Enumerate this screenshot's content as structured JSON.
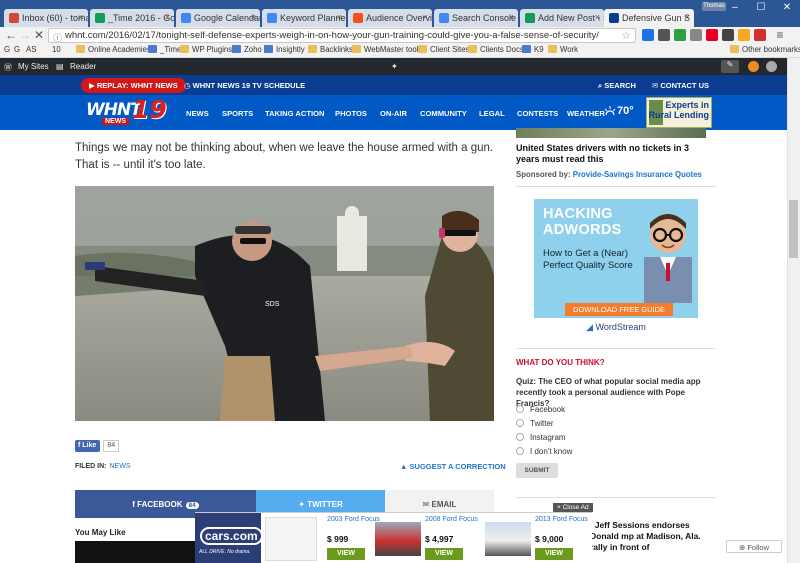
{
  "browser": {
    "tabs": [
      {
        "title": "Inbox (60) - toman",
        "color": "#d44638"
      },
      {
        "title": "_Time 2016 - Goog",
        "color": "#0f9d58"
      },
      {
        "title": "Google Calendar -",
        "color": "#4285f4"
      },
      {
        "title": "Keyword Planner -",
        "color": "#4285f4"
      },
      {
        "title": "Audience Overview",
        "color": "#f4511e"
      },
      {
        "title": "Search Console - C",
        "color": "#4285f4"
      },
      {
        "title": "Add New Post ‹ Se",
        "color": "#0f9d58"
      },
      {
        "title": "Defensive Gun S",
        "color": "#0a3d91"
      }
    ],
    "user_badge": "Thomas",
    "url": "whnt.com/2016/02/17/tonight-self-defense-experts-weigh-in-on-how-your-gun-training-could-give-you-a-false-sense-of-security/",
    "bookmarks": [
      "G",
      "G",
      "AS",
      "10",
      "Online Academies",
      "_Time",
      "WP Plugins",
      "Zoho",
      "Insightly",
      "Backlinks",
      "WebMaster tools",
      "Client Sites",
      "Clients Docs",
      "K9",
      "Work"
    ],
    "other_bookmarks": "Other bookmarks"
  },
  "wpbar": {
    "my_sites": "My Sites",
    "reader": "Reader"
  },
  "site": {
    "replay": "REPLAY: WHNT NEWS",
    "tv_schedule": "WHNT NEWS 19 TV SCHEDULE",
    "search": "SEARCH",
    "contact": "CONTACT US",
    "logo_text": "WHNT",
    "logo_num": "19",
    "logo_news": "NEWS",
    "nav": [
      "NEWS",
      "SPORTS",
      "TAKING ACTION",
      "PHOTOS",
      "ON-AIR",
      "COMMUNITY",
      "LEGAL",
      "CONTESTS",
      "WEATHER"
    ],
    "temp": "70°",
    "header_ad": "Experts in Rural Lending"
  },
  "article": {
    "lead": "Things we may not be thinking about, when we leave the house armed with a gun. That is -- until it's too late.",
    "fb_like": "Like",
    "fb_count": "84",
    "filed_label": "FILED IN:",
    "filed_value": "NEWS",
    "suggest": "SUGGEST A CORRECTION",
    "share_facebook": "FACEBOOK",
    "share_facebook_count": "84",
    "share_twitter": "TWITTER",
    "share_email": "EMAIL",
    "you_may_like": "You May Like",
    "shirt_text": "SDS"
  },
  "sidebar": {
    "story": "United States drivers with no tickets in 3 years must read this",
    "sponsored_label": "Sponsored by:",
    "sponsored_by": "Provide-Savings Insurance Quotes",
    "ad_title": "HACKING ADWORDS",
    "ad_sub": "How to Get a (Near) Perfect Quality Score",
    "ad_cta": "DOWNLOAD FREE GUIDE",
    "ad_brand": "WordStream",
    "poll_title": "WHAT DO YOU THINK?",
    "poll_question": "Quiz: The CEO of what popular social media app recently took a personal audience with Pope Francis?",
    "poll_options": [
      "Facebook",
      "Twitter",
      "Instagram",
      "I don't know"
    ],
    "submit": "SUBMIT",
    "bottom_story": ". Jeff Sessions endorses Donald mp at Madison, Ala. rally in front of"
  },
  "bottom_ad": {
    "close": "× Close Ad",
    "brand": "cars.com",
    "slogan": "ALL DRIVE. No drama.",
    "cars": [
      {
        "name": "2003 Ford Focus",
        "price": "$ 999",
        "view": "VIEW"
      },
      {
        "name": "2008 Ford Focus",
        "price": "$ 4,997",
        "view": "VIEW"
      },
      {
        "name": "2013 Ford Focus",
        "price": "$ 9,000",
        "view": "VIEW"
      }
    ]
  },
  "follow": "Follow"
}
